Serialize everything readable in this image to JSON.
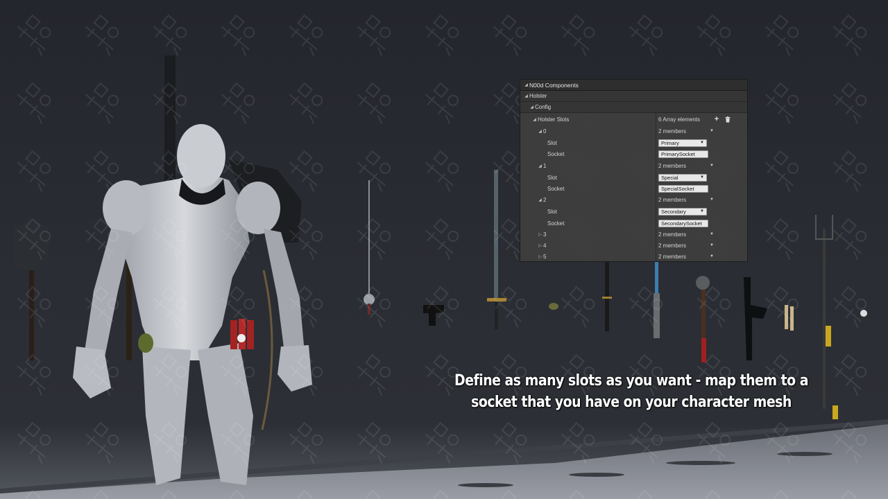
{
  "panel": {
    "title": "N00d Components",
    "category": "Holster",
    "subcategory": "Config",
    "holster_slots": {
      "label": "Holster Slots",
      "count_text": "6 Array elements"
    },
    "elements": [
      {
        "index": "0",
        "members": "2 members",
        "expanded": true,
        "slot_label": "Slot",
        "slot_value": "Primary",
        "socket_label": "Socket",
        "socket_value": "PrimarySocket"
      },
      {
        "index": "1",
        "members": "2 members",
        "expanded": true,
        "slot_label": "Slot",
        "slot_value": "Special",
        "socket_label": "Socket",
        "socket_value": "SpecialSocket"
      },
      {
        "index": "2",
        "members": "2 members",
        "expanded": true,
        "slot_label": "Slot",
        "slot_value": "Secondary",
        "socket_label": "Socket",
        "socket_value": "SecondarySocket"
      },
      {
        "index": "3",
        "members": "2 members",
        "expanded": false
      },
      {
        "index": "4",
        "members": "2 members",
        "expanded": false
      },
      {
        "index": "5",
        "members": "2 members",
        "expanded": false
      }
    ]
  },
  "caption": {
    "line1": "Define as many slots as you want - map them to a",
    "line2": "socket that you have on your character mesh"
  },
  "icons": {
    "add": "plus-icon",
    "delete": "trash-icon",
    "expanded": "triangle-down-icon",
    "collapsed": "triangle-right-icon"
  },
  "colors": {
    "panel_bg": "#3e3e3e",
    "panel_header": "#2e2e2e",
    "field_bg": "#e8e8e8",
    "caption_text": "#ffffff"
  }
}
